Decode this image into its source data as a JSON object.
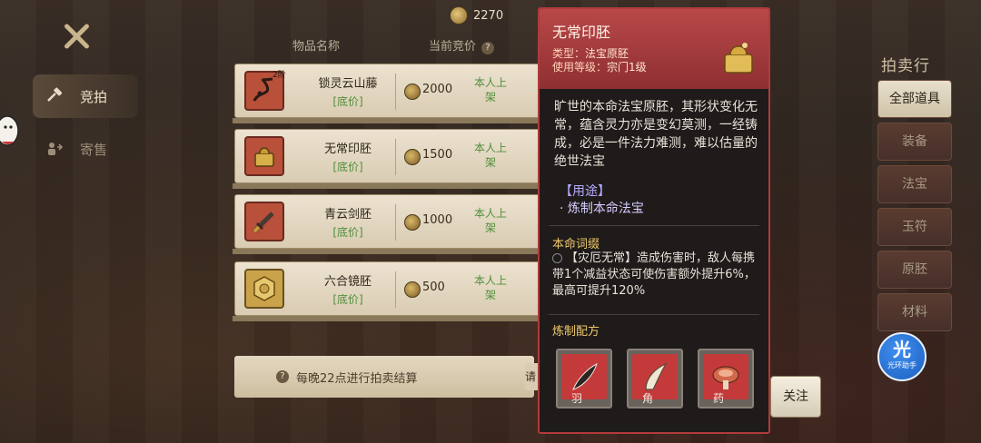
{
  "currency": {
    "amount": "2270"
  },
  "nav": {
    "auction": "竞拍",
    "consign": "寄售"
  },
  "columns": {
    "name": "物品名称",
    "price": "当前竞价",
    "price_hint": "?"
  },
  "items": [
    {
      "name": "锁灵云山藤",
      "floor": "[底价]",
      "price": "2000",
      "seller": "本人上架",
      "badge": "2阶"
    },
    {
      "name": "无常印胚",
      "floor": "[底价]",
      "price": "1500",
      "seller": "本人上架",
      "badge": ""
    },
    {
      "name": "青云剑胚",
      "floor": "[底价]",
      "price": "1000",
      "seller": "本人上架",
      "badge": ""
    },
    {
      "name": "六合镜胚",
      "floor": "[底价]",
      "price": "500",
      "seller": "本人上架",
      "badge": ""
    }
  ],
  "hint": {
    "text": "每晚22点进行拍卖结算",
    "icon": "?",
    "stub": "请"
  },
  "categories": {
    "title": "拍卖行",
    "items": [
      "全部道具",
      "装备",
      "法宝",
      "玉符",
      "原胚",
      "材料"
    ]
  },
  "assistant": {
    "big": "光",
    "small": "光环助手"
  },
  "follow": "关注",
  "tooltip": {
    "name": "无常印胚",
    "type_label": "类型：",
    "type": "法宝原胚",
    "level_label": "使用等级：",
    "level": "宗门1级",
    "desc": "旷世的本命法宝原胚，其形状变化无常，蕴含灵力亦是变幻莫测，一经铸成，必是一件法力难测，难以估量的绝世法宝",
    "use_title": "【用途】",
    "use_item": "· 炼制本命法宝",
    "effect_title": "本命词缀",
    "effect": "【灾厄无常】造成伤害时，敌人每携带1个减益状态可使伤害额外提升6%，最高可提升120%",
    "recipe_title": "炼制配方",
    "materials": [
      "羽",
      "角",
      "药"
    ]
  }
}
